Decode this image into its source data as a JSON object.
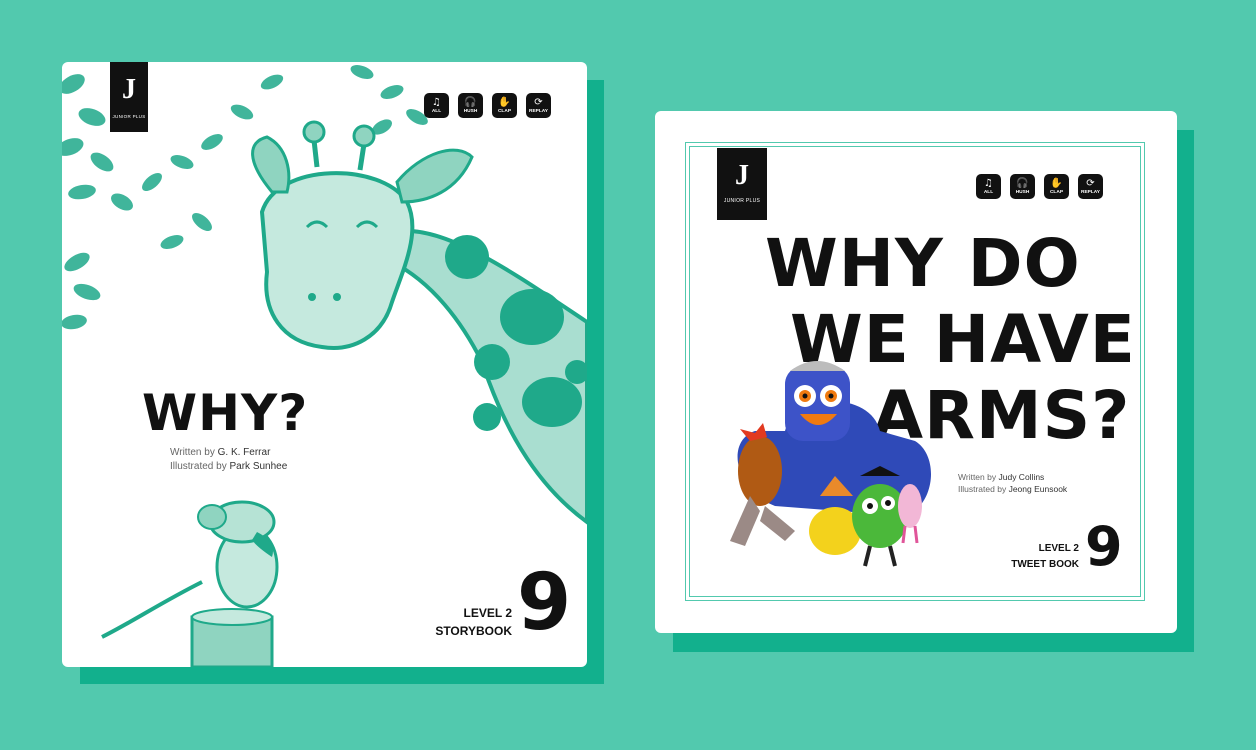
{
  "books": [
    {
      "brand": {
        "mark": "J",
        "label": "JUNIOR PLUS"
      },
      "controls": [
        {
          "icon": "♫",
          "label": "ALL"
        },
        {
          "icon": "🎧",
          "label": "HUSH"
        },
        {
          "icon": "✋",
          "label": "CLAP"
        },
        {
          "icon": "⟳",
          "label": "REPLAY"
        }
      ],
      "title": "WHY?",
      "written_prefix": "Written by",
      "author": "G. K. Ferrar",
      "illustrated_prefix": "Illustrated by",
      "illustrator": "Park Sunhee",
      "level": "LEVEL 2",
      "series": "STORYBOOK",
      "number": "9"
    },
    {
      "brand": {
        "mark": "J",
        "label": "JUNIOR PLUS"
      },
      "controls": [
        {
          "icon": "♫",
          "label": "ALL"
        },
        {
          "icon": "🎧",
          "label": "HUSH"
        },
        {
          "icon": "✋",
          "label": "CLAP"
        },
        {
          "icon": "⟳",
          "label": "REPLAY"
        }
      ],
      "title_lines": [
        "WHY DO",
        "WE HAVE",
        "ARMS?"
      ],
      "written_prefix": "Written by",
      "author": "Judy Collins",
      "illustrated_prefix": "Illustrated by",
      "illustrator": "Jeong Eunsook",
      "level": "LEVEL 2",
      "series": "TWEET BOOK",
      "number": "9"
    }
  ],
  "colors": {
    "background": "#52c9ae",
    "shadow": "#12b08d",
    "art_teal": "#1fa98a",
    "art_light": "#9fdcc9"
  }
}
